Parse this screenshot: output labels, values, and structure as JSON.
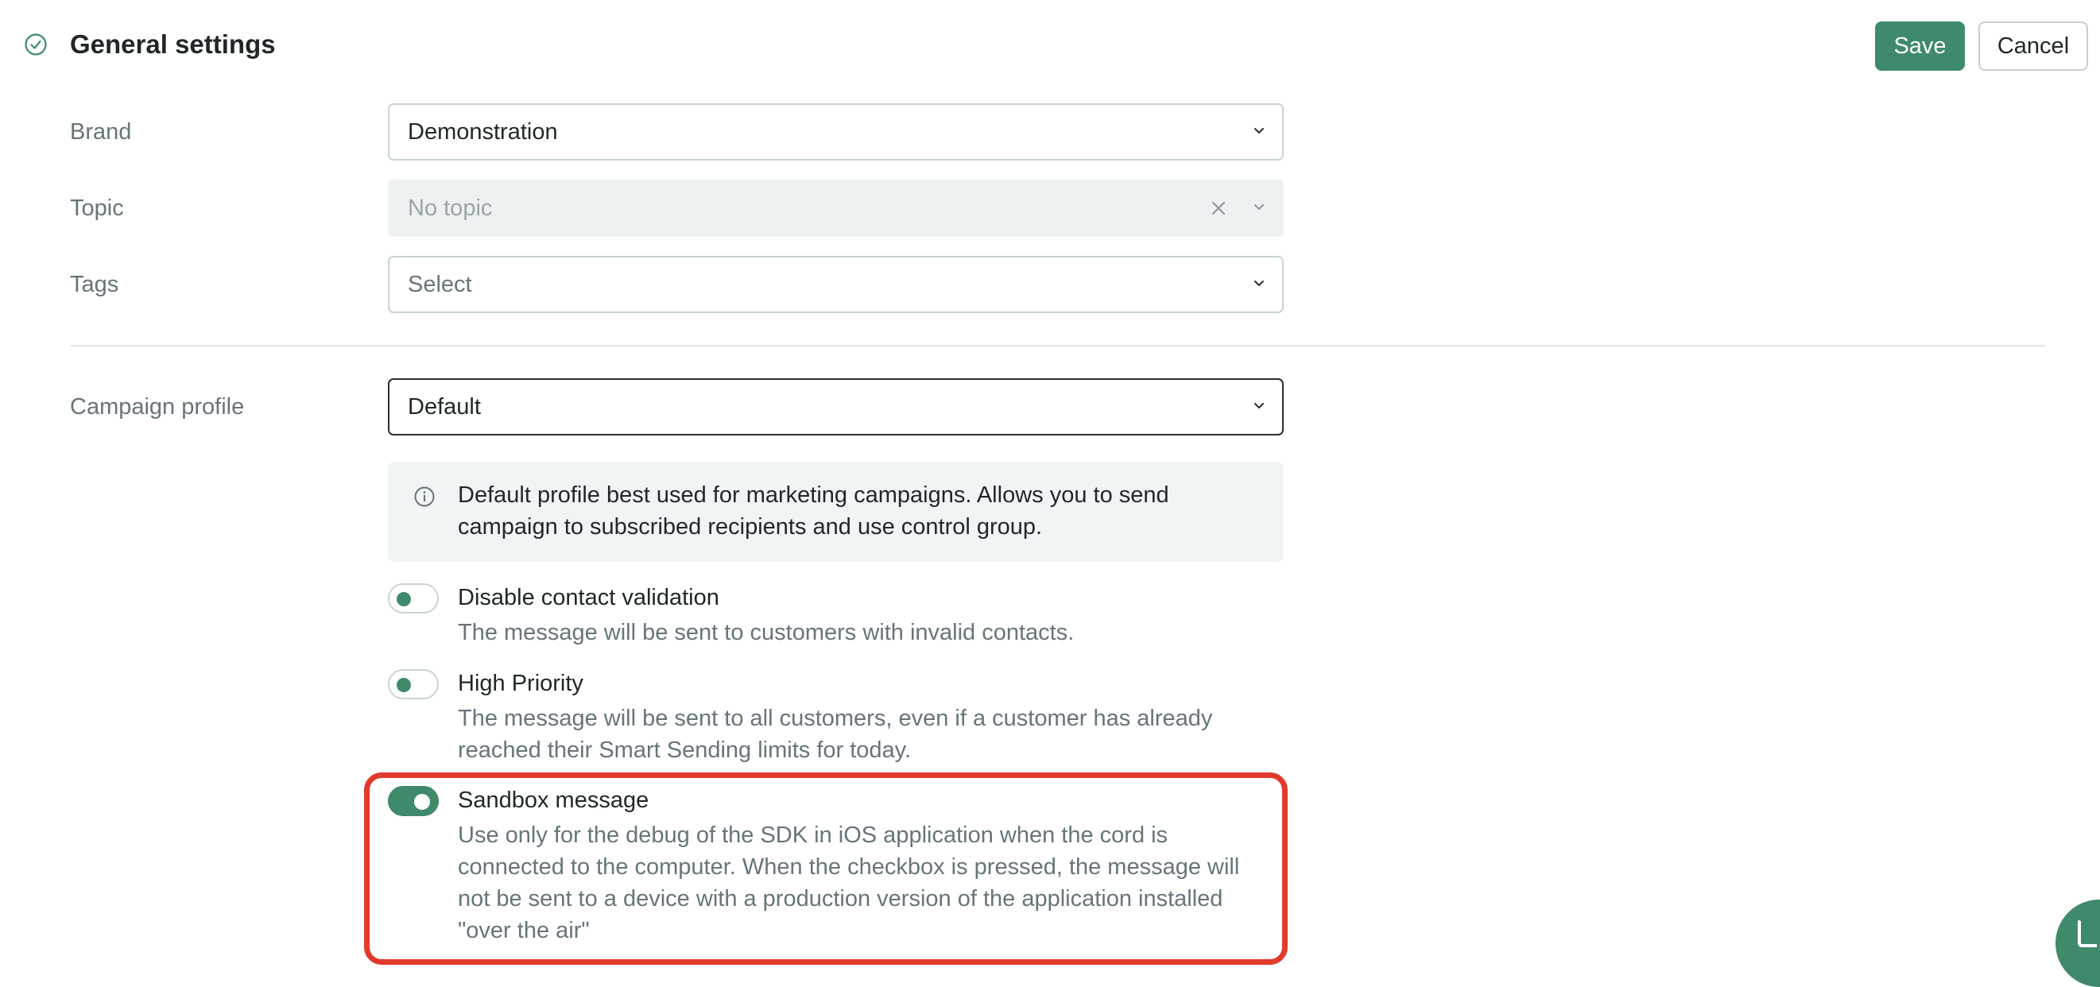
{
  "header": {
    "title": "General settings",
    "save_label": "Save",
    "cancel_label": "Cancel"
  },
  "fields": {
    "brand": {
      "label": "Brand",
      "value": "Demonstration"
    },
    "topic": {
      "label": "Topic",
      "placeholder": "No topic"
    },
    "tags": {
      "label": "Tags",
      "placeholder": "Select"
    },
    "campaign_profile": {
      "label": "Campaign profile",
      "value": "Default"
    }
  },
  "info": {
    "line1": "Default profile best used for marketing campaigns. Allows you to send",
    "line2": "campaign to subscribed recipients and use control group."
  },
  "options": [
    {
      "title": "Disable contact validation",
      "desc_lines": [
        "The message will be sent to customers with invalid contacts."
      ],
      "enabled": false
    },
    {
      "title": "High Priority",
      "desc_lines": [
        "The message will be sent to all customers, even if a customer has already",
        "reached their Smart Sending limits for today."
      ],
      "enabled": false
    },
    {
      "title": "Sandbox message",
      "desc_lines": [
        "Use only for the debug of the SDK in iOS application when the cord is",
        "connected to the computer. When the checkbox is pressed, the message will",
        "not be sent to a device with a production version of the application installed",
        "\"over the air\""
      ],
      "enabled": true
    }
  ],
  "colors": {
    "accent": "#3f8a6b",
    "highlight": "#e13a2c"
  }
}
